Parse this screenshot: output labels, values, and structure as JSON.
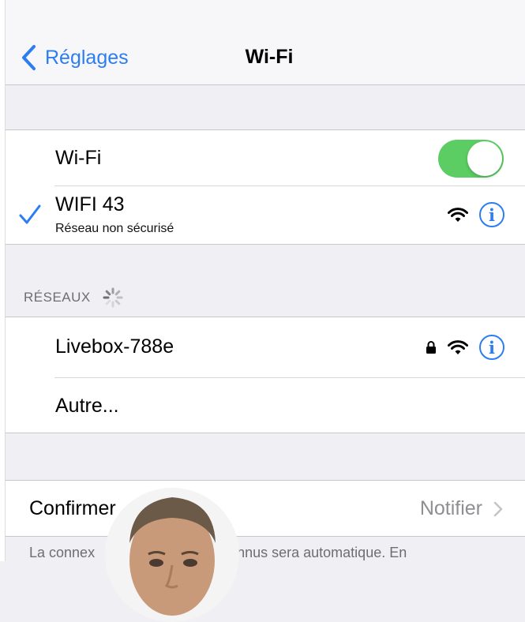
{
  "nav": {
    "back_label": "Réglages",
    "title": "Wi-Fi"
  },
  "wifi_toggle": {
    "label": "Wi-Fi",
    "on": true
  },
  "connected": {
    "name": "WIFI 43",
    "subtitle": "Réseau non sécurisé",
    "checked": true
  },
  "networks": {
    "header": "RÉSEAUX",
    "items": [
      {
        "name": "Livebox-788e",
        "secured": true
      },
      {
        "name": "Autre..."
      }
    ]
  },
  "confirm": {
    "label": "Confirmer",
    "value": "Notifier"
  },
  "footer": {
    "text_left": "La connex",
    "text_right": "onnus sera automatique. En"
  },
  "colors": {
    "accent": "#2c7df2",
    "toggle_on": "#5ccd63",
    "grouped_bg": "#efeff4"
  },
  "icons": [
    "chevron-left-icon",
    "checkmark-icon",
    "wifi-icon",
    "lock-icon",
    "info-icon",
    "spinner-icon",
    "chevron-right-icon"
  ]
}
